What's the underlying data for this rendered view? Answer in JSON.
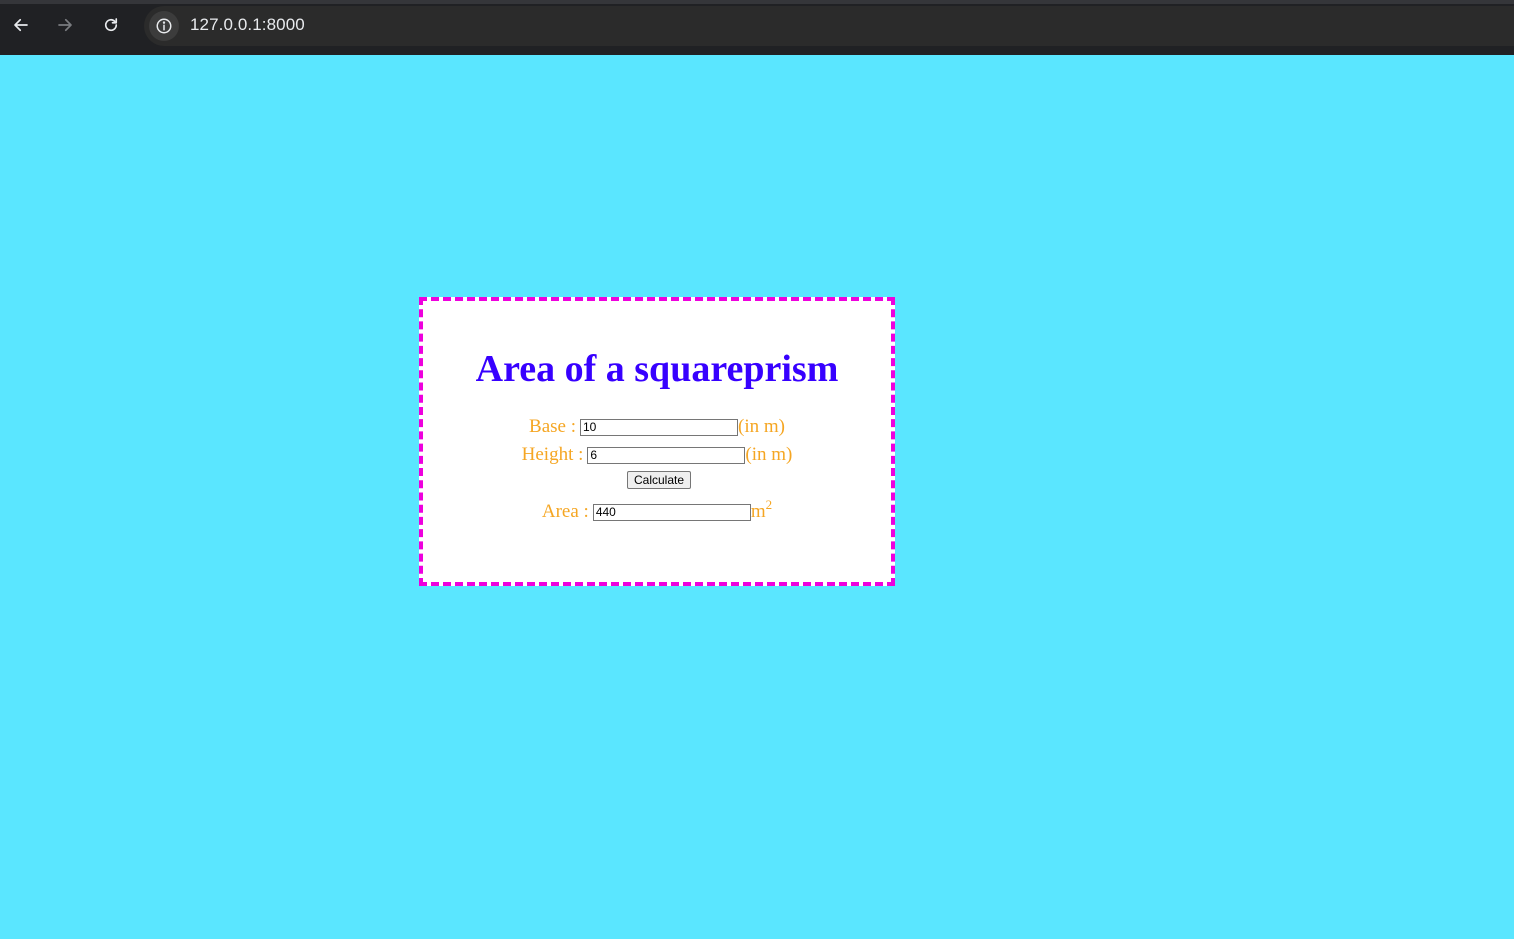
{
  "browser": {
    "url": "127.0.0.1:8000"
  },
  "icons": {
    "back": "back-arrow-icon",
    "forward": "forward-arrow-icon",
    "reload": "reload-icon",
    "site_info": "info-icon"
  },
  "page": {
    "background_color": "#5ae6ff",
    "card_border_color": "#ee00dd",
    "title_color": "#3700ff",
    "label_color": "#f5a623",
    "title": "Area of a squareprism",
    "base": {
      "label": "Base :",
      "value": "10",
      "unit": "(in m)"
    },
    "height": {
      "label": "Height :",
      "value": "6",
      "unit": "(in m)"
    },
    "calculate_label": "Calculate",
    "area": {
      "label": "Area :",
      "value": "440",
      "unit": "m",
      "unit_sup": "2"
    }
  }
}
